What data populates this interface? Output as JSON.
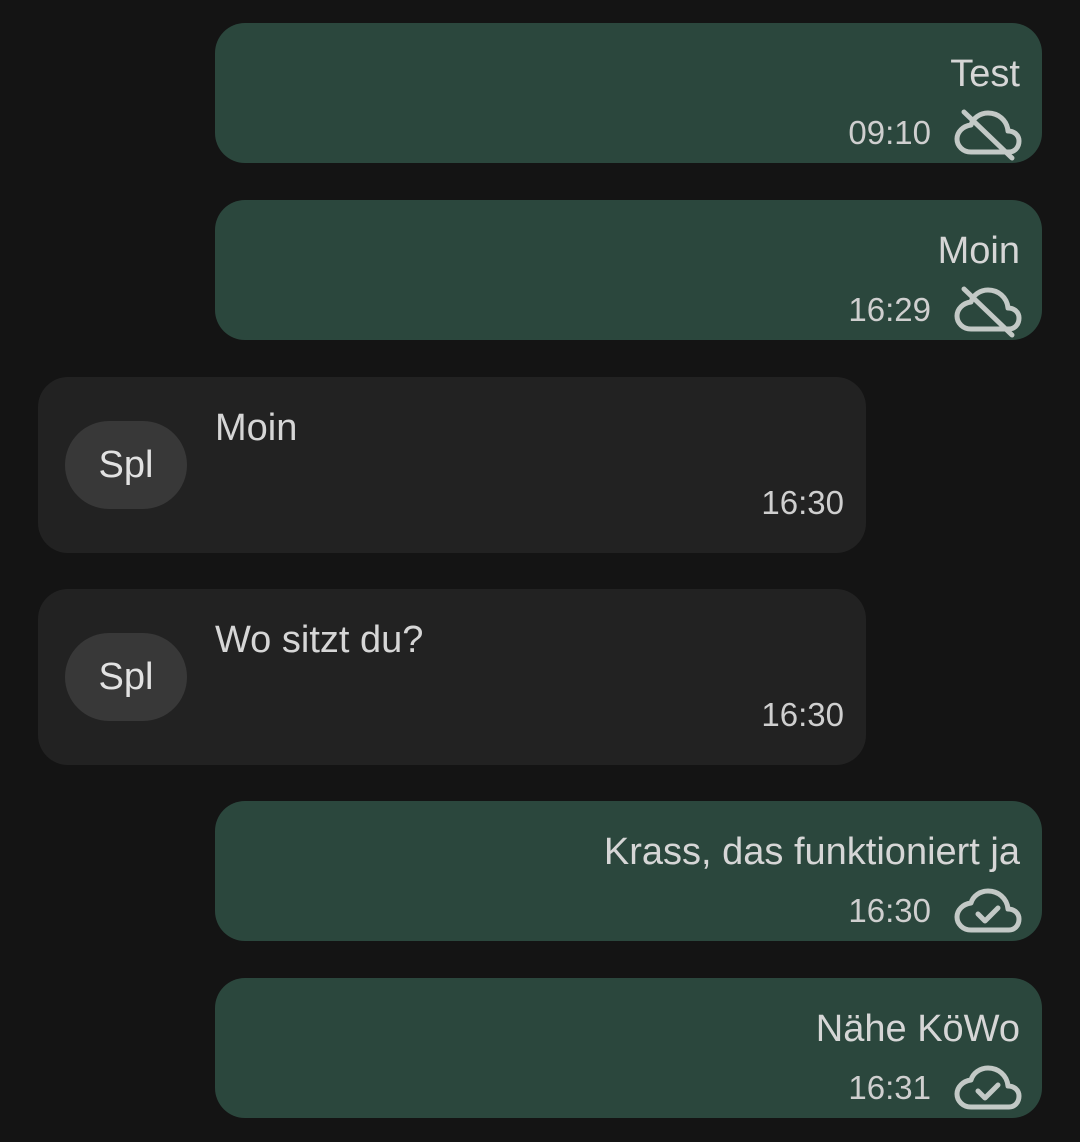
{
  "messages": [
    {
      "direction": "out",
      "text": "Test",
      "time": "09:10",
      "status_icon": "cloud-off-icon"
    },
    {
      "direction": "out",
      "text": "Moin",
      "time": "16:29",
      "status_icon": "cloud-off-icon"
    },
    {
      "direction": "in",
      "sender_initials": "Spl",
      "text": "Moin",
      "time": "16:30"
    },
    {
      "direction": "in",
      "sender_initials": "Spl",
      "text": "Wo sitzt du?",
      "time": "16:30"
    },
    {
      "direction": "out",
      "text": "Krass, das funktioniert ja",
      "time": "16:30",
      "status_icon": "cloud-check-icon"
    },
    {
      "direction": "out",
      "text": "Nähe KöWo",
      "time": "16:31",
      "status_icon": "cloud-check-icon"
    }
  ],
  "colors": {
    "background": "#141414",
    "outgoing_bubble": "#2b473d",
    "incoming_bubble": "#222222",
    "avatar": "#383838",
    "text": "#d6d6d6",
    "icon": "#c3c9c6"
  }
}
